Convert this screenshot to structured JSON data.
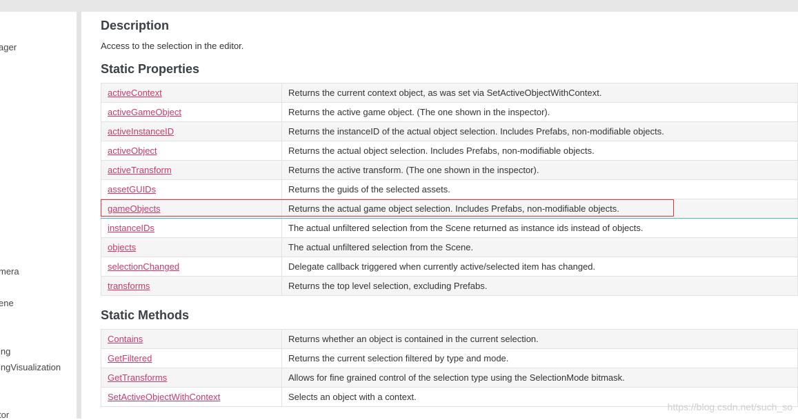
{
  "sidebar": {
    "items": [
      "ager",
      "mera",
      "ene",
      "ing",
      "ingVisualization",
      "tor"
    ]
  },
  "description": {
    "heading": "Description",
    "text": "Access to the selection in the editor."
  },
  "static_properties": {
    "heading": "Static Properties",
    "rows": [
      {
        "name": "activeContext",
        "desc": "Returns the current context object, as was set via SetActiveObjectWithContext."
      },
      {
        "name": "activeGameObject",
        "desc": "Returns the active game object. (The one shown in the inspector)."
      },
      {
        "name": "activeInstanceID",
        "desc": "Returns the instanceID of the actual object selection. Includes Prefabs, non-modifiable objects."
      },
      {
        "name": "activeObject",
        "desc": "Returns the actual object selection. Includes Prefabs, non-modifiable objects."
      },
      {
        "name": "activeTransform",
        "desc": "Returns the active transform. (The one shown in the inspector)."
      },
      {
        "name": "assetGUIDs",
        "desc": "Returns the guids of the selected assets."
      },
      {
        "name": "gameObjects",
        "desc": "Returns the actual game object selection. Includes Prefabs, non-modifiable objects."
      },
      {
        "name": "instanceIDs",
        "desc": "The actual unfiltered selection from the Scene returned as instance ids instead of objects."
      },
      {
        "name": "objects",
        "desc": "The actual unfiltered selection from the Scene."
      },
      {
        "name": "selectionChanged",
        "desc": "Delegate callback triggered when currently active/selected item has changed."
      },
      {
        "name": "transforms",
        "desc": "Returns the top level selection, excluding Prefabs."
      }
    ]
  },
  "static_methods": {
    "heading": "Static Methods",
    "rows": [
      {
        "name": "Contains",
        "desc": "Returns whether an object is contained in the current selection."
      },
      {
        "name": "GetFiltered",
        "desc": "Returns the current selection filtered by type and mode."
      },
      {
        "name": "GetTransforms",
        "desc": "Allows for fine grained control of the selection type using the SelectionMode bitmask."
      },
      {
        "name": "SetActiveObjectWithContext",
        "desc": "Selects an object with a context."
      }
    ]
  },
  "watermark": "https://blog.csdn.net/such_so",
  "colors": {
    "link": "#c93a6a",
    "highlight_border": "#d9363e",
    "row_alt": "#f5f5f5"
  }
}
